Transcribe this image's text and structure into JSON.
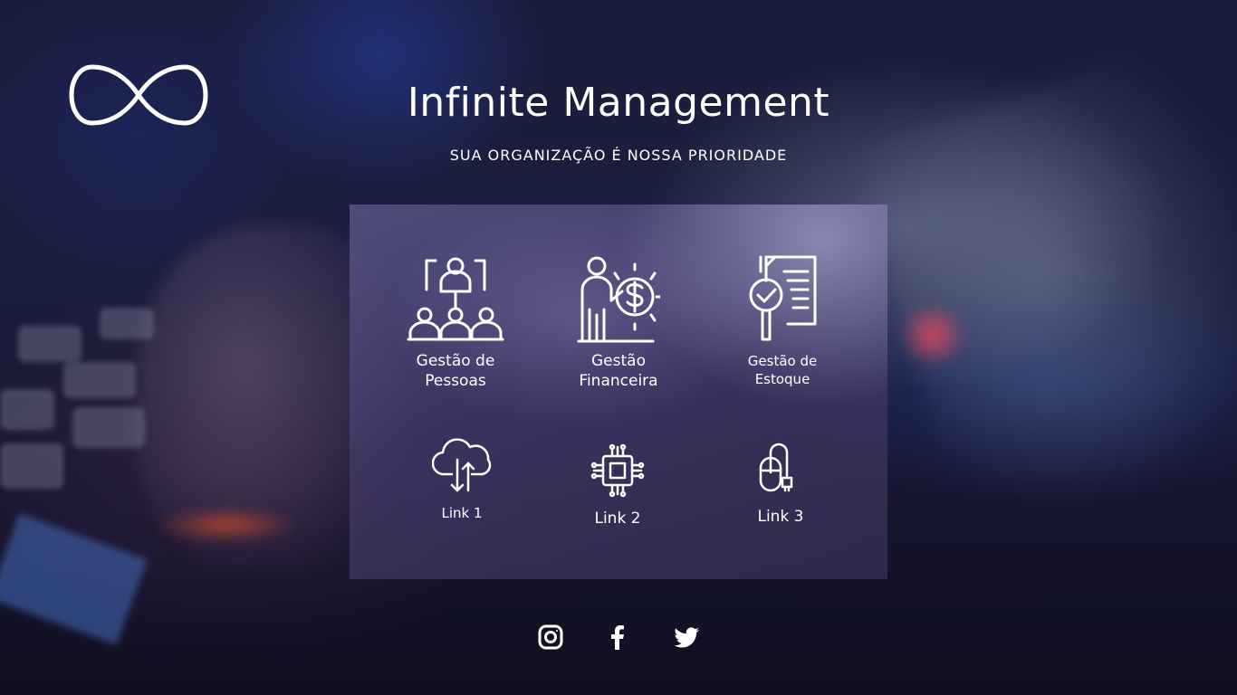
{
  "brand": {
    "logo_icon": "infinity-icon",
    "title": "Infinite Management",
    "tagline": "SUA ORGANIZAÇÃO É NOSSA PRIORIDADE"
  },
  "modules": [
    {
      "label": "Gestão de\nPessoas",
      "icon": "team-management-icon"
    },
    {
      "label": "Gestão\nFinanceira",
      "icon": "finance-icon"
    },
    {
      "label": "Gestão de\nEstoque",
      "icon": "inventory-document-icon"
    }
  ],
  "links": [
    {
      "label": "Link 1",
      "icon": "cloud-transfer-icon"
    },
    {
      "label": "Link 2",
      "icon": "chip-icon"
    },
    {
      "label": "Link 3",
      "icon": "mouse-icon"
    }
  ],
  "social": [
    {
      "name": "instagram",
      "icon": "instagram-icon"
    },
    {
      "name": "facebook",
      "icon": "facebook-icon"
    },
    {
      "name": "twitter",
      "icon": "twitter-icon"
    }
  ],
  "colors": {
    "text": "#ffffff",
    "background": "#14172c",
    "panel": "#5a5290"
  }
}
